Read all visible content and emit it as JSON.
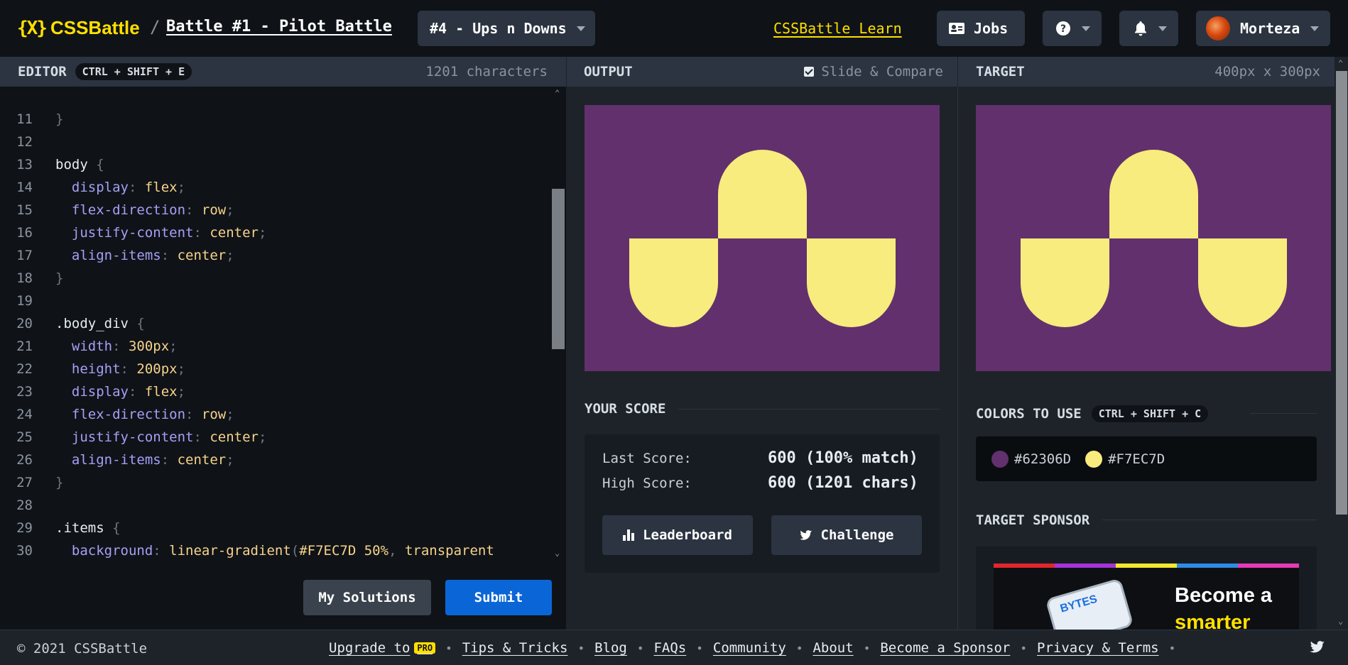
{
  "header": {
    "logo_mark": "{X}",
    "logo_text": "CSSBattle",
    "separator": "/",
    "battle_title": "Battle #1 - Pilot Battle",
    "target_select": "#4 - Ups n Downs",
    "learn_link": "CSSBattle Learn",
    "jobs_label": "Jobs",
    "user_name": "Morteza"
  },
  "editor": {
    "title": "EDITOR",
    "shortcut": "CTRL + SHIFT + E",
    "char_count": "1201 characters",
    "lines": [
      {
        "n": "11",
        "tokens": [
          {
            "c": "t-punc",
            "t": "}"
          }
        ]
      },
      {
        "n": "12",
        "tokens": []
      },
      {
        "n": "13",
        "tokens": [
          {
            "c": "t-sel",
            "t": "body "
          },
          {
            "c": "t-punc",
            "t": "{"
          }
        ]
      },
      {
        "n": "14",
        "tokens": [
          {
            "c": "t-prop",
            "t": "  display"
          },
          {
            "c": "t-punc",
            "t": ": "
          },
          {
            "c": "t-val",
            "t": "flex"
          },
          {
            "c": "t-punc",
            "t": ";"
          }
        ]
      },
      {
        "n": "15",
        "tokens": [
          {
            "c": "t-prop",
            "t": "  flex-direction"
          },
          {
            "c": "t-punc",
            "t": ": "
          },
          {
            "c": "t-val",
            "t": "row"
          },
          {
            "c": "t-punc",
            "t": ";"
          }
        ]
      },
      {
        "n": "16",
        "tokens": [
          {
            "c": "t-prop",
            "t": "  justify-content"
          },
          {
            "c": "t-punc",
            "t": ": "
          },
          {
            "c": "t-val",
            "t": "center"
          },
          {
            "c": "t-punc",
            "t": ";"
          }
        ]
      },
      {
        "n": "17",
        "tokens": [
          {
            "c": "t-prop",
            "t": "  align-items"
          },
          {
            "c": "t-punc",
            "t": ": "
          },
          {
            "c": "t-val",
            "t": "center"
          },
          {
            "c": "t-punc",
            "t": ";"
          }
        ]
      },
      {
        "n": "18",
        "tokens": [
          {
            "c": "t-punc",
            "t": "}"
          }
        ]
      },
      {
        "n": "19",
        "tokens": []
      },
      {
        "n": "20",
        "tokens": [
          {
            "c": "t-sel",
            "t": ".body_div "
          },
          {
            "c": "t-punc",
            "t": "{"
          }
        ]
      },
      {
        "n": "21",
        "tokens": [
          {
            "c": "t-prop",
            "t": "  width"
          },
          {
            "c": "t-punc",
            "t": ": "
          },
          {
            "c": "t-val",
            "t": "300px"
          },
          {
            "c": "t-punc",
            "t": ";"
          }
        ]
      },
      {
        "n": "22",
        "tokens": [
          {
            "c": "t-prop",
            "t": "  height"
          },
          {
            "c": "t-punc",
            "t": ": "
          },
          {
            "c": "t-val",
            "t": "200px"
          },
          {
            "c": "t-punc",
            "t": ";"
          }
        ]
      },
      {
        "n": "23",
        "tokens": [
          {
            "c": "t-prop",
            "t": "  display"
          },
          {
            "c": "t-punc",
            "t": ": "
          },
          {
            "c": "t-val",
            "t": "flex"
          },
          {
            "c": "t-punc",
            "t": ";"
          }
        ]
      },
      {
        "n": "24",
        "tokens": [
          {
            "c": "t-prop",
            "t": "  flex-direction"
          },
          {
            "c": "t-punc",
            "t": ": "
          },
          {
            "c": "t-val",
            "t": "row"
          },
          {
            "c": "t-punc",
            "t": ";"
          }
        ]
      },
      {
        "n": "25",
        "tokens": [
          {
            "c": "t-prop",
            "t": "  justify-content"
          },
          {
            "c": "t-punc",
            "t": ": "
          },
          {
            "c": "t-val",
            "t": "center"
          },
          {
            "c": "t-punc",
            "t": ";"
          }
        ]
      },
      {
        "n": "26",
        "tokens": [
          {
            "c": "t-prop",
            "t": "  align-items"
          },
          {
            "c": "t-punc",
            "t": ": "
          },
          {
            "c": "t-val",
            "t": "center"
          },
          {
            "c": "t-punc",
            "t": ";"
          }
        ]
      },
      {
        "n": "27",
        "tokens": [
          {
            "c": "t-punc",
            "t": "}"
          }
        ]
      },
      {
        "n": "28",
        "tokens": []
      },
      {
        "n": "29",
        "tokens": [
          {
            "c": "t-sel",
            "t": ".items "
          },
          {
            "c": "t-punc",
            "t": "{"
          }
        ]
      },
      {
        "n": "30",
        "tokens": [
          {
            "c": "t-prop",
            "t": "  background"
          },
          {
            "c": "t-punc",
            "t": ": "
          },
          {
            "c": "t-val",
            "t": "linear-gradient"
          },
          {
            "c": "t-punc",
            "t": "("
          },
          {
            "c": "t-val",
            "t": "#F7EC7D 50%"
          },
          {
            "c": "t-punc",
            "t": ", "
          },
          {
            "c": "t-val",
            "t": "transparent"
          }
        ]
      }
    ],
    "my_solutions_label": "My Solutions",
    "submit_label": "Submit"
  },
  "output": {
    "title": "OUTPUT",
    "slide_compare_label": "Slide & Compare",
    "slide_compare_checked": true
  },
  "target": {
    "title": "TARGET",
    "dimensions": "400px x 300px"
  },
  "score": {
    "title": "YOUR SCORE",
    "last_label": "Last Score:",
    "last_value": "600 (100% match)",
    "high_label": "High Score:",
    "high_value": "600 (1201 chars)",
    "leaderboard_label": "Leaderboard",
    "challenge_label": "Challenge"
  },
  "colors": {
    "title": "COLORS TO USE",
    "shortcut": "CTRL + SHIFT + C",
    "list": [
      {
        "hex": "#62306D"
      },
      {
        "hex": "#F7EC7D"
      }
    ]
  },
  "sponsor": {
    "title": "TARGET SPONSOR",
    "phone_text": "BYTES",
    "headline_1": "Become a",
    "headline_2": "smarter",
    "stripe_colors": [
      "#e0262b",
      "#a534d8",
      "#f5e72d",
      "#2f8be6",
      "#e63ab4"
    ]
  },
  "footer": {
    "copyright": "© 2021 CSSBattle",
    "upgrade_label": "Upgrade to",
    "pro_badge": "PRO",
    "links": [
      "Tips & Tricks",
      "Blog",
      "FAQs",
      "Community",
      "About",
      "Become a Sponsor",
      "Privacy & Terms"
    ]
  },
  "theme": {
    "accent": "#ffdf00",
    "submit_blue": "#0a66d6",
    "canvas_bg": "#62306d",
    "shape_color": "#f7ec7d"
  }
}
